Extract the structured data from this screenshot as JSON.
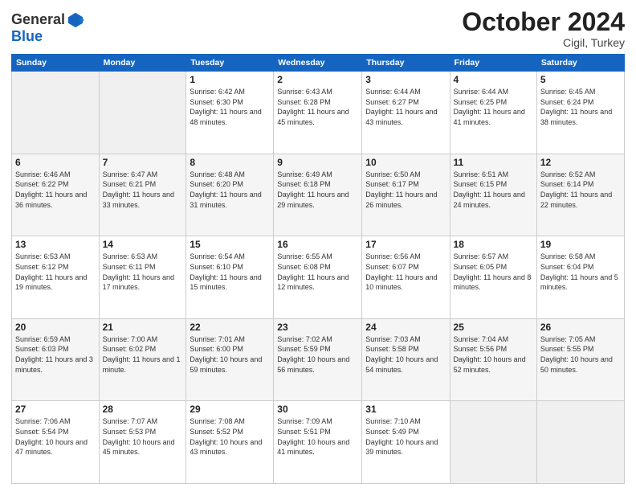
{
  "header": {
    "logo_general": "General",
    "logo_blue": "Blue",
    "title": "October 2024",
    "subtitle": "Cigil, Turkey"
  },
  "days_of_week": [
    "Sunday",
    "Monday",
    "Tuesday",
    "Wednesday",
    "Thursday",
    "Friday",
    "Saturday"
  ],
  "weeks": [
    [
      {
        "day": "",
        "info": ""
      },
      {
        "day": "",
        "info": ""
      },
      {
        "day": "1",
        "info": "Sunrise: 6:42 AM\nSunset: 6:30 PM\nDaylight: 11 hours and 48 minutes."
      },
      {
        "day": "2",
        "info": "Sunrise: 6:43 AM\nSunset: 6:28 PM\nDaylight: 11 hours and 45 minutes."
      },
      {
        "day": "3",
        "info": "Sunrise: 6:44 AM\nSunset: 6:27 PM\nDaylight: 11 hours and 43 minutes."
      },
      {
        "day": "4",
        "info": "Sunrise: 6:44 AM\nSunset: 6:25 PM\nDaylight: 11 hours and 41 minutes."
      },
      {
        "day": "5",
        "info": "Sunrise: 6:45 AM\nSunset: 6:24 PM\nDaylight: 11 hours and 38 minutes."
      }
    ],
    [
      {
        "day": "6",
        "info": "Sunrise: 6:46 AM\nSunset: 6:22 PM\nDaylight: 11 hours and 36 minutes."
      },
      {
        "day": "7",
        "info": "Sunrise: 6:47 AM\nSunset: 6:21 PM\nDaylight: 11 hours and 33 minutes."
      },
      {
        "day": "8",
        "info": "Sunrise: 6:48 AM\nSunset: 6:20 PM\nDaylight: 11 hours and 31 minutes."
      },
      {
        "day": "9",
        "info": "Sunrise: 6:49 AM\nSunset: 6:18 PM\nDaylight: 11 hours and 29 minutes."
      },
      {
        "day": "10",
        "info": "Sunrise: 6:50 AM\nSunset: 6:17 PM\nDaylight: 11 hours and 26 minutes."
      },
      {
        "day": "11",
        "info": "Sunrise: 6:51 AM\nSunset: 6:15 PM\nDaylight: 11 hours and 24 minutes."
      },
      {
        "day": "12",
        "info": "Sunrise: 6:52 AM\nSunset: 6:14 PM\nDaylight: 11 hours and 22 minutes."
      }
    ],
    [
      {
        "day": "13",
        "info": "Sunrise: 6:53 AM\nSunset: 6:12 PM\nDaylight: 11 hours and 19 minutes."
      },
      {
        "day": "14",
        "info": "Sunrise: 6:53 AM\nSunset: 6:11 PM\nDaylight: 11 hours and 17 minutes."
      },
      {
        "day": "15",
        "info": "Sunrise: 6:54 AM\nSunset: 6:10 PM\nDaylight: 11 hours and 15 minutes."
      },
      {
        "day": "16",
        "info": "Sunrise: 6:55 AM\nSunset: 6:08 PM\nDaylight: 11 hours and 12 minutes."
      },
      {
        "day": "17",
        "info": "Sunrise: 6:56 AM\nSunset: 6:07 PM\nDaylight: 11 hours and 10 minutes."
      },
      {
        "day": "18",
        "info": "Sunrise: 6:57 AM\nSunset: 6:05 PM\nDaylight: 11 hours and 8 minutes."
      },
      {
        "day": "19",
        "info": "Sunrise: 6:58 AM\nSunset: 6:04 PM\nDaylight: 11 hours and 5 minutes."
      }
    ],
    [
      {
        "day": "20",
        "info": "Sunrise: 6:59 AM\nSunset: 6:03 PM\nDaylight: 11 hours and 3 minutes."
      },
      {
        "day": "21",
        "info": "Sunrise: 7:00 AM\nSunset: 6:02 PM\nDaylight: 11 hours and 1 minute."
      },
      {
        "day": "22",
        "info": "Sunrise: 7:01 AM\nSunset: 6:00 PM\nDaylight: 10 hours and 59 minutes."
      },
      {
        "day": "23",
        "info": "Sunrise: 7:02 AM\nSunset: 5:59 PM\nDaylight: 10 hours and 56 minutes."
      },
      {
        "day": "24",
        "info": "Sunrise: 7:03 AM\nSunset: 5:58 PM\nDaylight: 10 hours and 54 minutes."
      },
      {
        "day": "25",
        "info": "Sunrise: 7:04 AM\nSunset: 5:56 PM\nDaylight: 10 hours and 52 minutes."
      },
      {
        "day": "26",
        "info": "Sunrise: 7:05 AM\nSunset: 5:55 PM\nDaylight: 10 hours and 50 minutes."
      }
    ],
    [
      {
        "day": "27",
        "info": "Sunrise: 7:06 AM\nSunset: 5:54 PM\nDaylight: 10 hours and 47 minutes."
      },
      {
        "day": "28",
        "info": "Sunrise: 7:07 AM\nSunset: 5:53 PM\nDaylight: 10 hours and 45 minutes."
      },
      {
        "day": "29",
        "info": "Sunrise: 7:08 AM\nSunset: 5:52 PM\nDaylight: 10 hours and 43 minutes."
      },
      {
        "day": "30",
        "info": "Sunrise: 7:09 AM\nSunset: 5:51 PM\nDaylight: 10 hours and 41 minutes."
      },
      {
        "day": "31",
        "info": "Sunrise: 7:10 AM\nSunset: 5:49 PM\nDaylight: 10 hours and 39 minutes."
      },
      {
        "day": "",
        "info": ""
      },
      {
        "day": "",
        "info": ""
      }
    ]
  ]
}
